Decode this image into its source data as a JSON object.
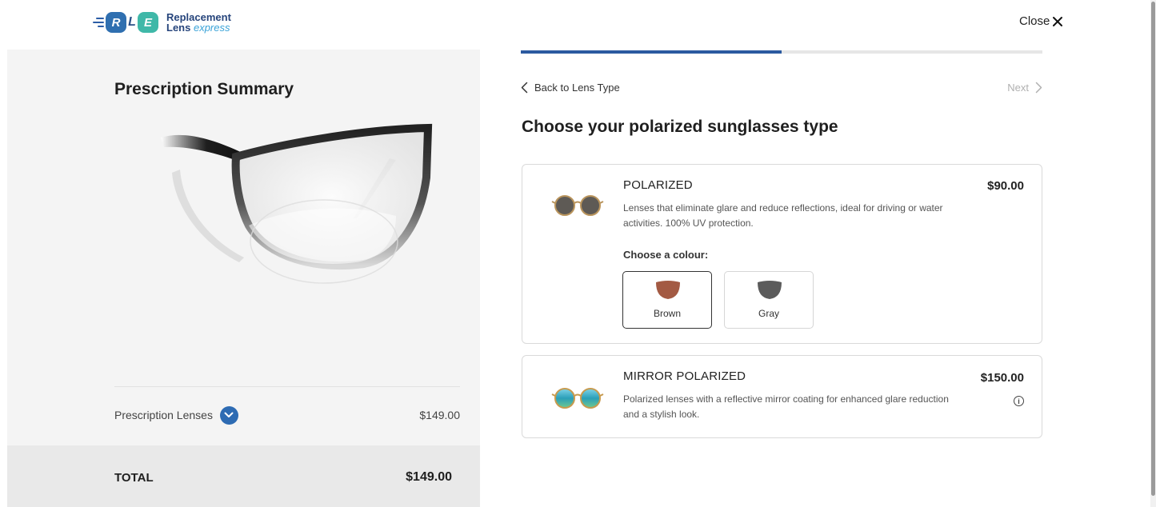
{
  "header": {
    "logo_badges": [
      "R",
      "L",
      "E"
    ],
    "logo_line1": "Replacement",
    "logo_line2": "Lens",
    "logo_line3": "express",
    "close_label": "Close",
    "close_icon": "close-x-icon"
  },
  "summary": {
    "title": "Prescription Summary",
    "lens_label": "Prescription Lenses",
    "lens_price": "$149.00",
    "total_label": "TOTAL",
    "total_value": "$149.00"
  },
  "wizard": {
    "progress": 0.5,
    "back_label": "Back to Lens Type",
    "next_label": "Next",
    "title": "Choose your polarized sunglasses type"
  },
  "options": [
    {
      "name": "POLARIZED",
      "price": "$90.00",
      "description": "Lenses that eliminate glare and reduce reflections, ideal for driving or water activities. 100% UV protection.",
      "colour_label": "Choose a colour:",
      "colours": [
        {
          "label": "Brown",
          "color": "#a35a43",
          "selected": true
        },
        {
          "label": "Gray",
          "color": "#5b5b5b",
          "selected": false
        }
      ]
    },
    {
      "name": "MIRROR POLARIZED",
      "price": "$150.00",
      "description": "Polarized lenses with a reflective mirror coating for enhanced glare reduction and a stylish look.",
      "info_icon": "i"
    }
  ],
  "colors": {
    "accent": "#2d6bb3",
    "progress": "#2b5aa0",
    "teal": "#3fb8a8"
  }
}
